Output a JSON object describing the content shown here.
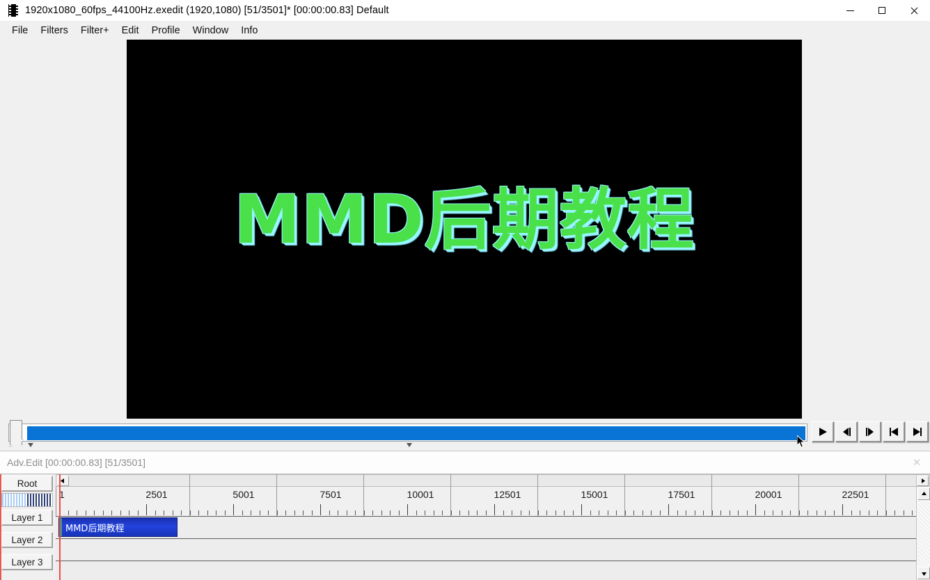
{
  "window": {
    "icon": "film-strip-icon",
    "title": "1920x1080_60fps_44100Hz.exedit (1920,1080)  [51/3501]* [00:00:00.83]  Default",
    "controls": {
      "minimize": "minimize-icon",
      "maximize": "maximize-icon",
      "close": "close-icon"
    }
  },
  "menubar": {
    "items": [
      {
        "label": "File"
      },
      {
        "label": "Filters"
      },
      {
        "label": "Filter+"
      },
      {
        "label": "Edit"
      },
      {
        "label": "Profile"
      },
      {
        "label": "Window"
      },
      {
        "label": "Info"
      }
    ]
  },
  "preview": {
    "text": "MMD后期教程",
    "background_color": "#000000",
    "text_color": "#4ae04a",
    "outline_color": "#9af6ff"
  },
  "seekbar": {
    "value_label": "00:00:00.83",
    "frame_label": "51/3501",
    "fill_color": "#0a73d6"
  },
  "transport": {
    "buttons": [
      {
        "name": "play-button",
        "icon": "play-icon"
      },
      {
        "name": "previous-frame-button",
        "icon": "step-back-icon"
      },
      {
        "name": "next-frame-button",
        "icon": "step-forward-icon"
      },
      {
        "name": "jump-to-start-button",
        "icon": "skip-start-icon"
      },
      {
        "name": "jump-to-end-button",
        "icon": "skip-end-icon"
      }
    ]
  },
  "advedit": {
    "title": "Adv.Edit [00:00:00.83] [51/3501]",
    "close_label": "✕"
  },
  "timeline": {
    "root_button": "Root",
    "layers": [
      {
        "label": "Layer  1"
      },
      {
        "label": "Layer  2"
      },
      {
        "label": "Layer  3"
      }
    ],
    "ruler_labels": [
      "1",
      "2501",
      "5001",
      "7501",
      "10001",
      "12501",
      "15001",
      "17501",
      "20001",
      "22501"
    ],
    "clip": {
      "label": "MMD后期教程",
      "layer": 1,
      "color": "#2344dd",
      "handle_color": "#1fa89a"
    },
    "playhead_color": "#f04b42",
    "scroll_left_icon": "arrow-left-icon",
    "scroll_right_icon": "arrow-right-icon",
    "scroll_up_icon": "arrow-up-icon",
    "scroll_down_icon": "arrow-down-icon"
  }
}
